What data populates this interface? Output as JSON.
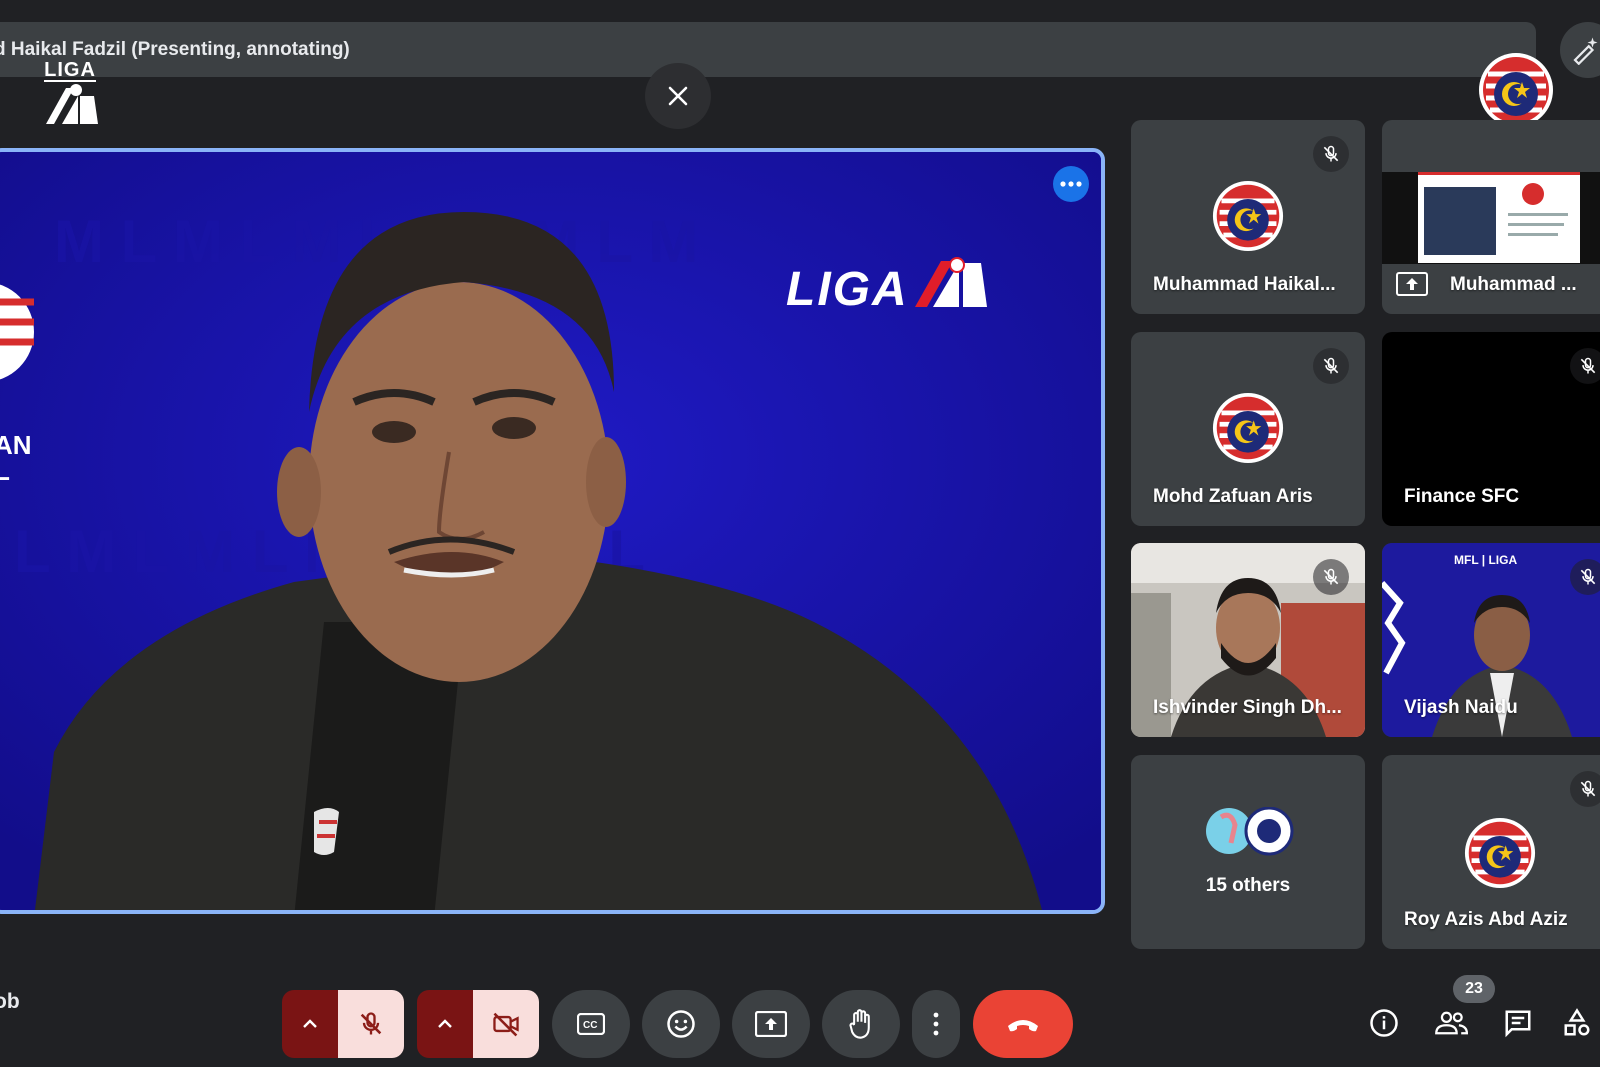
{
  "presenting_bar": {
    "text": "d Haikal Fadzil (Presenting, annotating)"
  },
  "main_speaker": {
    "background_logo_text": "LIGA",
    "side_text_line1": "AN",
    "side_text_line2": "L"
  },
  "top_left_logo": {
    "text": "LIGA"
  },
  "participants": [
    {
      "name": "Muhammad Haikal...",
      "muted": true,
      "type": "avatar"
    },
    {
      "name": "Muhammad ...",
      "muted": false,
      "type": "presentation"
    },
    {
      "name": "Mohd Zafuan Aris",
      "muted": true,
      "type": "avatar"
    },
    {
      "name": "Finance SFC",
      "muted": true,
      "type": "blank"
    },
    {
      "name": "Ishvinder Singh Dh...",
      "muted": true,
      "type": "video"
    },
    {
      "name": "Vijash Naidu",
      "muted": true,
      "type": "video",
      "header_text": "MFL | LIGA"
    },
    {
      "name": "15 others",
      "muted": false,
      "type": "others"
    },
    {
      "name": "Roy Azis Abd Aziz",
      "muted": true,
      "type": "avatar"
    }
  ],
  "controls": {
    "meeting_code": "ob",
    "people_count": "23"
  },
  "colors": {
    "background": "#202124",
    "tile": "#3c4043",
    "active_border": "#8ab4f8",
    "end_call": "#ea4335",
    "muted_dark": "#7a1414",
    "muted_light": "#f9dedc",
    "brand_blue": "#1a14b0"
  }
}
